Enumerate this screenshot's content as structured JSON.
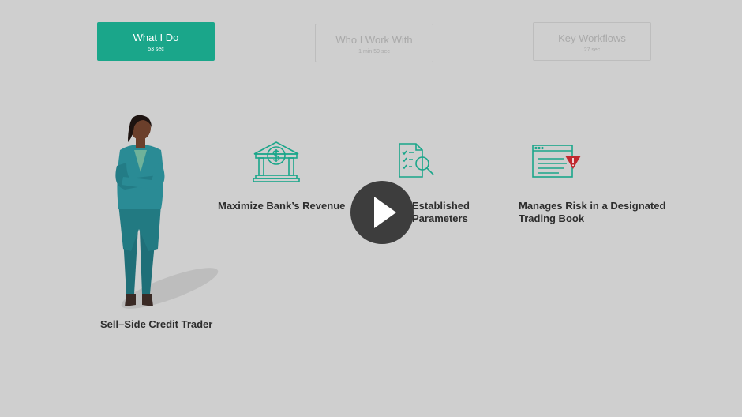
{
  "tabs": [
    {
      "label": "What I Do",
      "duration": "53 sec",
      "active": true
    },
    {
      "label": "Who I Work With",
      "duration": "1 min 59 sec",
      "active": false
    },
    {
      "label": "Key Workflows",
      "duration": "27 sec",
      "active": false
    }
  ],
  "character": {
    "role": "Sell–Side Credit Trader"
  },
  "responsibilities": [
    {
      "icon": "bank-dollar-icon",
      "label": "Maximize Bank’s Revenue"
    },
    {
      "icon": "checklist-search-icon",
      "label_line1": "Established",
      "label_line2": "Parameters"
    },
    {
      "icon": "browser-alert-icon",
      "label_line1": "Manages Risk in a Designated",
      "label_line2": "Trading Book"
    }
  ],
  "colors": {
    "accent": "#1aa68a",
    "background": "#cfcfcf",
    "play": "#3d3d3d",
    "alert": "#c0282f"
  }
}
